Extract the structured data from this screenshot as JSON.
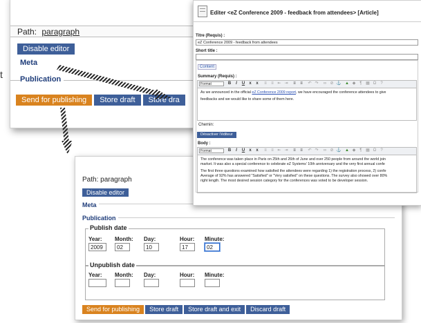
{
  "panel1": {
    "path_label": "Path:",
    "path_value": "paragraph",
    "disable_editor": "Disable editor",
    "meta": "Meta",
    "publication": "Publication",
    "send_for_publishing": "Send for publishing",
    "store_draft": "Store draft",
    "store_draft_truncated": "Store dra"
  },
  "panel2": {
    "title": "Editer <eZ Conference 2009 - feedback from attendees> [Article]",
    "title_label": "Titre (Requis) :",
    "title_value": "eZ Conference 2009 - feedback from attendees",
    "short_title_label": "Short title :",
    "content_label": "Content",
    "summary_label": "Summary (Requis) :",
    "format": "Format",
    "summary_text_1": "As we announced in the official ",
    "summary_link": "eZ Conference 2009 report",
    "summary_text_2": ", we have encouraged the conference attendees to give",
    "summary_text_3": "feedbacks and we would like to share some of them here.",
    "chemin_label": "Chemin:",
    "deactivate_editor": "Désactiver l'éditeur",
    "body_label": "Body :",
    "body_p1_l1": "The conference was taken place in Paris on 25th and 26th of June and over 250 people from around the world join",
    "body_p1_l2": "market. It was also a special conference to celebrate eZ Systems' 10th anniversary and the very first annual confe",
    "body_p2_l1": "The first three questions examined how satisfied the attendees were regarding 1) the registration process, 2) confe",
    "body_p2_l2": "Average of 92% has answered \"Satisfied\" or \"Very satisfied\" on these questions. The survey also showed over 80%",
    "body_p2_l3": "right length. The most desired session category for the conferences was voted to be developer session."
  },
  "panel3": {
    "path_label": "Path: paragraph",
    "disable_editor": "Disable editor",
    "meta": "Meta",
    "publication": "Publication",
    "publish_date": "Publish date",
    "unpublish_date": "Unpublish date",
    "year": "Year:",
    "month": "Month:",
    "day": "Day:",
    "hour": "Hour:",
    "minute": "Minute:",
    "year_value": "2009",
    "month_value": "02",
    "day_value": "10",
    "hour_value": "17",
    "minute_value": "02",
    "send_for_publishing": "Send for publishing",
    "store_draft": "Store draft",
    "store_draft_and_exit": "Store draft and exit",
    "discard_draft": "Discard draft"
  },
  "edge_char": "t",
  "colors": {
    "button_blue": "#3e5f99",
    "button_orange": "#d9831f",
    "section_blue": "#1f3d7a",
    "link": "#2a4fb3"
  }
}
